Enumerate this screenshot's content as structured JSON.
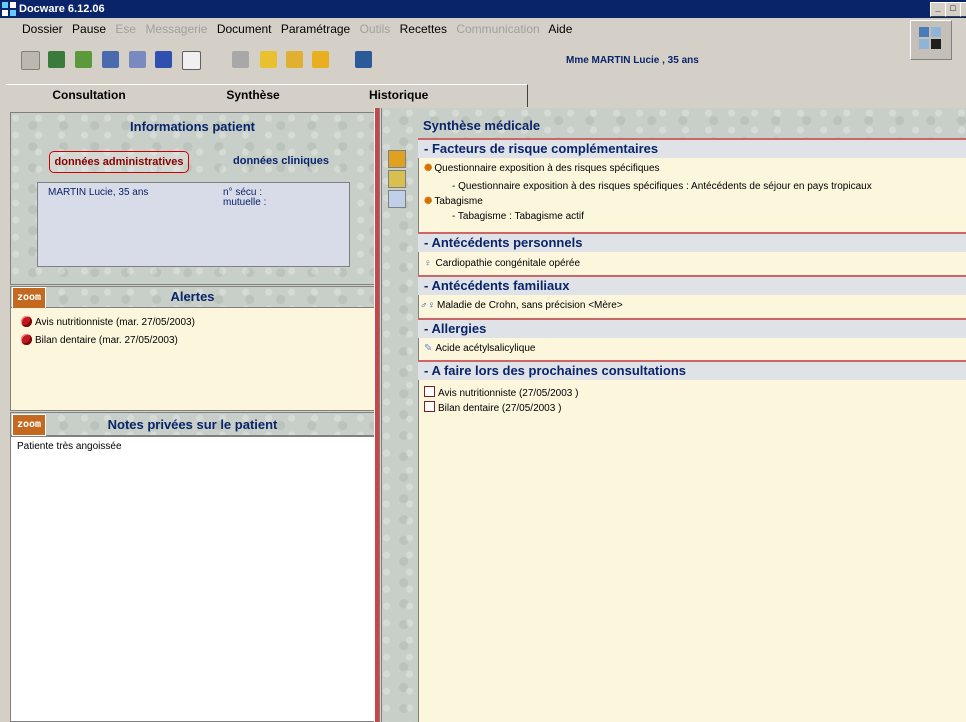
{
  "window": {
    "title": "Docware 6.12.06",
    "controls": [
      "_",
      "□",
      "×"
    ]
  },
  "menu": [
    {
      "label": "Dossier",
      "enabled": true
    },
    {
      "label": "Pause",
      "enabled": true
    },
    {
      "label": "Ese",
      "enabled": false
    },
    {
      "label": "Messagerie",
      "enabled": false
    },
    {
      "label": "Document",
      "enabled": true
    },
    {
      "label": "Paramétrage",
      "enabled": true
    },
    {
      "label": "Outils",
      "enabled": false
    },
    {
      "label": "Recettes",
      "enabled": true
    },
    {
      "label": "Communication",
      "enabled": false
    },
    {
      "label": "Aide",
      "enabled": true
    }
  ],
  "toolbar": {
    "icons": [
      "patient-icon",
      "family-icon",
      "pencil-icon",
      "chart-icon",
      "edit-icon",
      "arrow-icon",
      "document-icon",
      "printer-icon",
      "check-folder-icon",
      "cross-folder-icon",
      "open-folder-icon",
      "hospital-icon"
    ],
    "patient_header": "Mme  MARTIN Lucie , 35 ans"
  },
  "tabs": [
    {
      "label": "Consultation",
      "active": false
    },
    {
      "label": "Synthèse",
      "active": true
    },
    {
      "label": "Historique",
      "active": false
    }
  ],
  "info_patient": {
    "title": "Informations patient",
    "btn_admin": "données administratives",
    "btn_clin": "données cliniques",
    "name_age": "MARTIN Lucie, 35 ans",
    "secu": "n° sécu :",
    "mutuelle": "mutuelle :"
  },
  "alertes": {
    "zoom": "zoom",
    "title": "Alertes",
    "items": [
      "Avis nutritionniste (mar. 27/05/2003)",
      "Bilan dentaire (mar. 27/05/2003)"
    ]
  },
  "notes": {
    "zoom": "zoom",
    "title": "Notes privées sur le patient",
    "text": "Patiente très angoissée"
  },
  "synthese": {
    "title": "Synthèse médicale",
    "sections": {
      "facteurs": {
        "header": "- Facteurs de risque complémentaires",
        "l1": "Questionnaire exposition à des risques spécifiques",
        "l2": "- Questionnaire exposition à des risques spécifiques : Antécédents de séjour en pays tropicaux",
        "l3": "Tabagisme",
        "l4": "- Tabagisme : Tabagisme actif"
      },
      "perso": {
        "header": "- Antécédents personnels",
        "l1": "Cardiopathie congénitale opérée"
      },
      "familiaux": {
        "header": "- Antécédents familiaux",
        "l1": "Maladie de Crohn, sans précision <Mère>"
      },
      "allergies": {
        "header": "- Allergies",
        "l1": "Acide acétylsalicylique"
      },
      "afaire": {
        "header": "- A faire lors des prochaines consultations",
        "l1": "Avis nutritionniste (27/05/2003 )",
        "l2": "Bilan dentaire (27/05/2003 )"
      }
    }
  },
  "colors": {
    "titlebar": "#0a246a",
    "accent": "#0a246a",
    "section_border": "#cc6666",
    "zoom": "#c46a20"
  }
}
